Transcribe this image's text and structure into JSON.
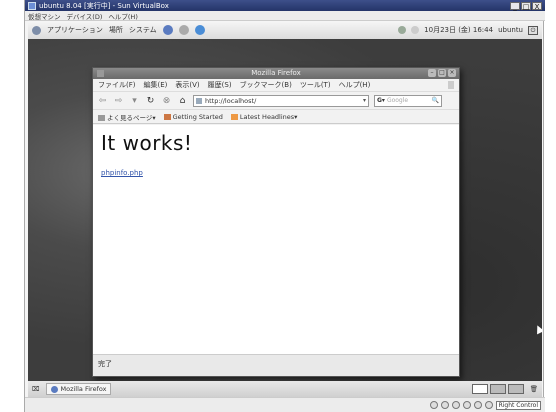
{
  "host": {
    "title": "ubuntu 8.04 [実行中] - Sun VirtualBox",
    "window_buttons": [
      "_",
      "□",
      "X"
    ],
    "menu": [
      "仮想マシン",
      "デバイス(D)",
      "ヘルプ(H)"
    ],
    "status_hotkey": "Right Control"
  },
  "guest_panel": {
    "items": [
      "アプリケーション",
      "場所",
      "システム"
    ],
    "datetime": "10月23日 (金) 16:44",
    "user": "ubuntu"
  },
  "firefox": {
    "title": "Mozilla Firefox",
    "menu": [
      "ファイル(F)",
      "編集(E)",
      "表示(V)",
      "履歴(S)",
      "ブックマーク(B)",
      "ツール(T)",
      "ヘルプ(H)"
    ],
    "url": "http://localhost/",
    "search_placeholder": "Google",
    "bookmarks": [
      "よく見るページ▾",
      "Getting Started",
      "Latest Headlines▾"
    ],
    "page_heading": "It works!",
    "page_link": "phpinfo.php",
    "status": "完了"
  },
  "taskbar": {
    "task": "Mozilla Firefox"
  }
}
